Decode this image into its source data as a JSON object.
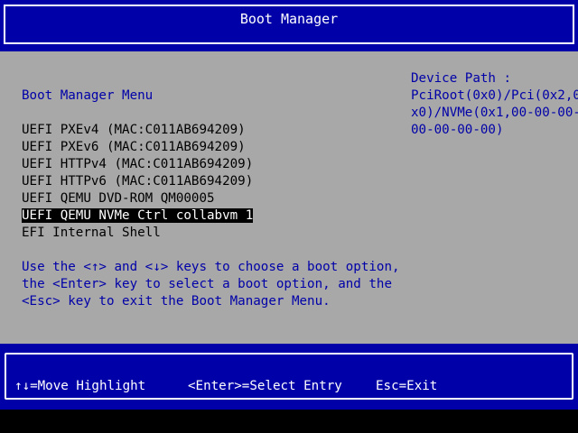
{
  "header": {
    "title": "Boot Manager"
  },
  "menu": {
    "title": "Boot Manager Menu",
    "entries": [
      {
        "label": "UEFI PXEv4 (MAC:C011AB694209)",
        "selected": false
      },
      {
        "label": "UEFI PXEv6 (MAC:C011AB694209)",
        "selected": false
      },
      {
        "label": "UEFI HTTPv4 (MAC:C011AB694209)",
        "selected": false
      },
      {
        "label": "UEFI HTTPv6 (MAC:C011AB694209)",
        "selected": false
      },
      {
        "label": "UEFI QEMU DVD-ROM QM00005",
        "selected": false
      },
      {
        "label": "UEFI QEMU NVMe Ctrl collabvm 1",
        "selected": true
      },
      {
        "label": "EFI Internal Shell",
        "selected": false
      }
    ]
  },
  "help": {
    "lines": [
      "Use the <↑> and <↓> keys to choose a boot option,",
      "the <Enter> key to select a boot option, and the",
      "<Esc> key to exit the Boot Manager Menu."
    ]
  },
  "device_path": {
    "lines": [
      "Device Path :",
      "PciRoot(0x0)/Pci(0x2,0",
      "x0)/NVMe(0x1,00-00-00-",
      "00-00-00-00)"
    ]
  },
  "footer": {
    "move": "↑↓=Move Highlight",
    "select": "<Enter>=Select Entry",
    "exit": "Esc=Exit"
  },
  "colors": {
    "header_bg": "#0000a8",
    "main_bg": "#a8a8a8",
    "accent_text": "#0000a8",
    "selected_bg": "#000000",
    "selected_fg": "#ffffff"
  }
}
